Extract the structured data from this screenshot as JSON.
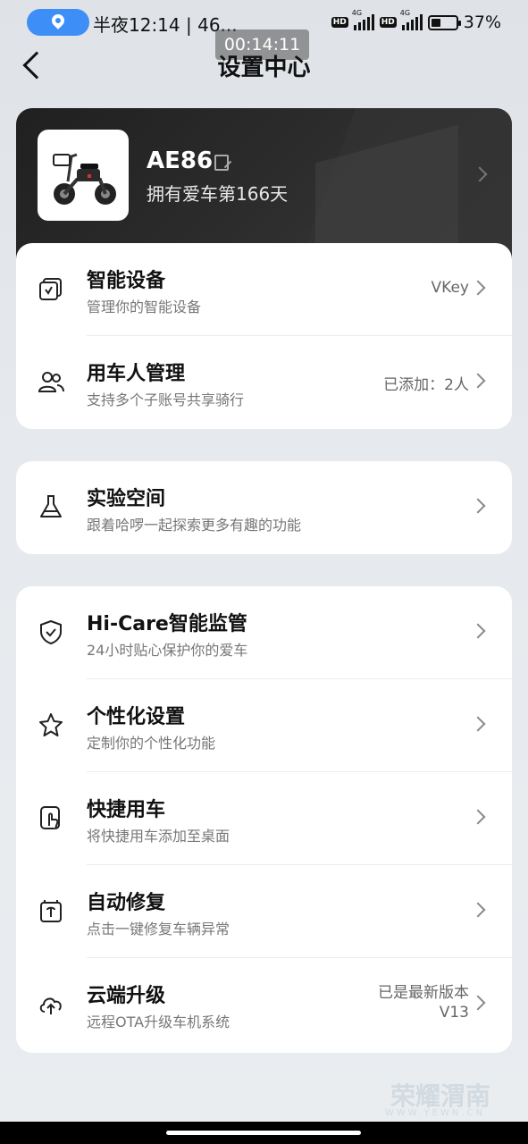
{
  "status_bar": {
    "time_text": "半夜12:14 | 46...",
    "recording_timer": "00:14:11",
    "battery_percent": "37%",
    "hd_label": "HD",
    "network_label": "4G"
  },
  "header": {
    "title": "设置中心"
  },
  "profile": {
    "car_name": "AE86",
    "ownership_text": "拥有爱车第166天"
  },
  "devices_card": [
    {
      "title": "智能设备",
      "subtitle": "管理你的智能设备",
      "value": "VKey"
    },
    {
      "title": "用车人管理",
      "subtitle": "支持多个子账号共享骑行",
      "value": "已添加：2人"
    }
  ],
  "lab_card": [
    {
      "title": "实验空间",
      "subtitle": "跟着哈啰一起探索更多有趣的功能"
    }
  ],
  "features_card": [
    {
      "title": "Hi-Care智能监管",
      "subtitle": "24小时贴心保护你的爱车"
    },
    {
      "title": "个性化设置",
      "subtitle": "定制你的个性化功能"
    },
    {
      "title": "快捷用车",
      "subtitle": "将快捷用车添加至桌面"
    },
    {
      "title": "自动修复",
      "subtitle": "点击一键修复车辆异常"
    },
    {
      "title": "云端升级",
      "subtitle": "远程OTA升级车机系统",
      "value_line1": "已是最新版本",
      "value_line2": "V13"
    }
  ],
  "watermark": {
    "text": "荣耀渭南",
    "sub": "WWW.YEWN.CN"
  },
  "colors": {
    "accent": "#3d8ef7",
    "profile_bg": "#262626",
    "card_bg": "#ffffff"
  }
}
